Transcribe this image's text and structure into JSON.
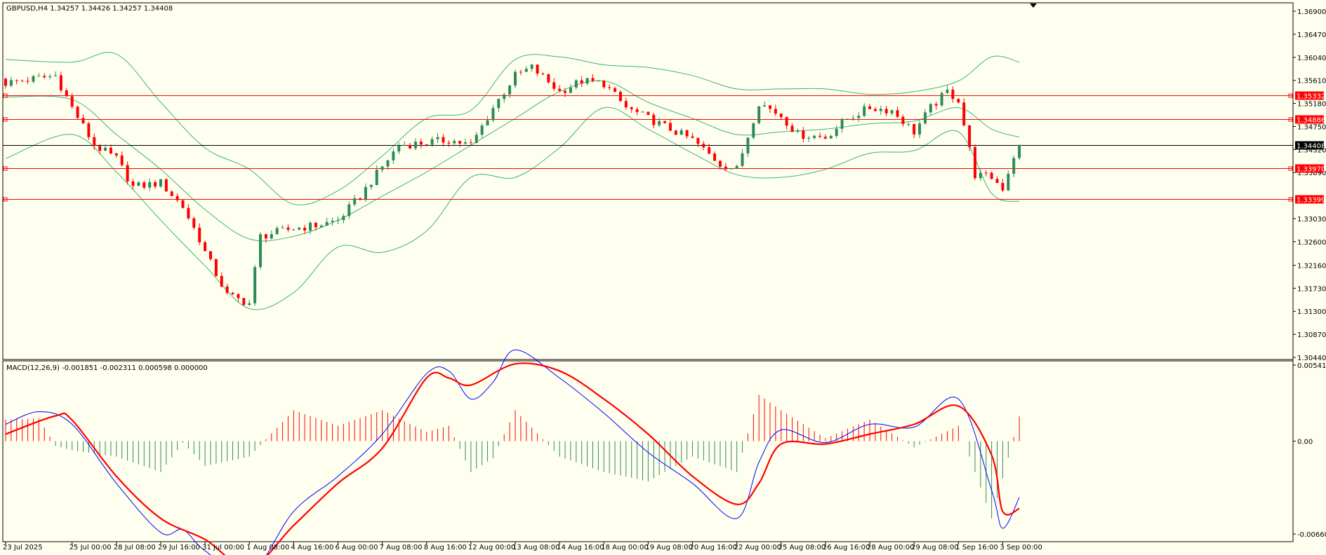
{
  "main_header": "GBPUSD,H4  1.34257 1.34426 1.34257 1.34408",
  "macd_header": "MACD(12,26,9) -0.001851 -0.002311 0.000598 0.000000",
  "colors": {
    "background": "#fffff0",
    "bull": "#2e8b57",
    "bear": "#ff0000",
    "bands": "#3cb371",
    "hline": "#ff0000",
    "current_price_line": "#000000",
    "macd_main": "#0000ff",
    "macd_signal": "#ff0000"
  },
  "chart_data": [
    {
      "type": "candlestick",
      "symbol": "GBPUSD",
      "timeframe": "H4",
      "last_ohlc": {
        "open": 1.34257,
        "high": 1.34426,
        "low": 1.34257,
        "close": 1.34408
      },
      "y_ticks": [
        "1.36900",
        "1.36470",
        "1.36040",
        "1.35610",
        "1.35180",
        "1.34750",
        "1.34320",
        "1.33890",
        "1.33030",
        "1.32600",
        "1.32160",
        "1.31730",
        "1.31300",
        "1.30870",
        "1.30440"
      ],
      "ylim": [
        1.3044,
        1.3694
      ],
      "x_ticks": [
        "23 Jul 2025",
        "25 Jul 00:00",
        "28 Jul 08:00",
        "29 Jul 16:00",
        "31 Jul 00:00",
        "1 Aug 08:00",
        "4 Aug 16:00",
        "6 Aug 00:00",
        "7 Aug 08:00",
        "8 Aug 16:00",
        "12 Aug 00:00",
        "13 Aug 08:00",
        "14 Aug 16:00",
        "18 Aug 00:00",
        "19 Aug 08:00",
        "20 Aug 16:00",
        "22 Aug 00:00",
        "25 Aug 08:00",
        "26 Aug 16:00",
        "28 Aug 00:00",
        "29 Aug 08:00",
        "1 Sep 16:00",
        "3 Sep 00:00"
      ],
      "indicator": "Bollinger Bands",
      "horizontal_levels": [
        {
          "label": "1.35332",
          "value": 1.35332
        },
        {
          "label": "1.34886",
          "value": 1.34886
        },
        {
          "label": "1.34408",
          "value": 1.34408,
          "current": true
        },
        {
          "label": "1.33970",
          "value": 1.3397
        },
        {
          "label": "1.33399",
          "value": 1.33399
        }
      ],
      "close_path": [
        {
          "x": "23 Jul 2025",
          "y": 1.3556
        },
        {
          "x": "24 Jul 12:00",
          "y": 1.357
        },
        {
          "x": "25 Jul 00:00",
          "y": 1.351
        },
        {
          "x": "25 Jul 16:00",
          "y": 1.344
        },
        {
          "x": "28 Jul 08:00",
          "y": 1.3415
        },
        {
          "x": "28 Jul 20:00",
          "y": 1.3362
        },
        {
          "x": "29 Jul 16:00",
          "y": 1.337
        },
        {
          "x": "30 Jul 08:00",
          "y": 1.3325
        },
        {
          "x": "30 Jul 20:00",
          "y": 1.3265
        },
        {
          "x": "31 Jul 00:00",
          "y": 1.324
        },
        {
          "x": "31 Jul 16:00",
          "y": 1.316
        },
        {
          "x": "1 Aug 08:00",
          "y": 1.3145
        },
        {
          "x": "1 Aug 16:00",
          "y": 1.327
        },
        {
          "x": "4 Aug 16:00",
          "y": 1.3285
        },
        {
          "x": "5 Aug 08:00",
          "y": 1.329
        },
        {
          "x": "6 Aug 00:00",
          "y": 1.33
        },
        {
          "x": "6 Aug 16:00",
          "y": 1.3345
        },
        {
          "x": "7 Aug 08:00",
          "y": 1.34
        },
        {
          "x": "7 Aug 20:00",
          "y": 1.344
        },
        {
          "x": "8 Aug 16:00",
          "y": 1.3445
        },
        {
          "x": "11 Aug 08:00",
          "y": 1.345
        },
        {
          "x": "12 Aug 00:00",
          "y": 1.344
        },
        {
          "x": "12 Aug 16:00",
          "y": 1.351
        },
        {
          "x": "13 Aug 08:00",
          "y": 1.357
        },
        {
          "x": "13 Aug 20:00",
          "y": 1.3585
        },
        {
          "x": "14 Aug 16:00",
          "y": 1.354
        },
        {
          "x": "15 Aug 08:00",
          "y": 1.356
        },
        {
          "x": "18 Aug 00:00",
          "y": 1.3555
        },
        {
          "x": "18 Aug 16:00",
          "y": 1.351
        },
        {
          "x": "19 Aug 08:00",
          "y": 1.349
        },
        {
          "x": "19 Aug 20:00",
          "y": 1.3475
        },
        {
          "x": "20 Aug 16:00",
          "y": 1.345
        },
        {
          "x": "21 Aug 12:00",
          "y": 1.3405
        },
        {
          "x": "22 Aug 00:00",
          "y": 1.3395
        },
        {
          "x": "22 Aug 16:00",
          "y": 1.352
        },
        {
          "x": "25 Aug 08:00",
          "y": 1.3495
        },
        {
          "x": "25 Aug 20:00",
          "y": 1.346
        },
        {
          "x": "26 Aug 16:00",
          "y": 1.3455
        },
        {
          "x": "27 Aug 08:00",
          "y": 1.349
        },
        {
          "x": "28 Aug 00:00",
          "y": 1.351
        },
        {
          "x": "28 Aug 16:00",
          "y": 1.3505
        },
        {
          "x": "29 Aug 08:00",
          "y": 1.3465
        },
        {
          "x": "29 Aug 20:00",
          "y": 1.351
        },
        {
          "x": "1 Sep 08:00",
          "y": 1.354
        },
        {
          "x": "1 Sep 16:00",
          "y": 1.3525
        },
        {
          "x": "2 Sep 04:00",
          "y": 1.3385
        },
        {
          "x": "2 Sep 16:00",
          "y": 1.338
        },
        {
          "x": "3 Sep 00:00",
          "y": 1.336
        },
        {
          "x": "3 Sep 08:00",
          "y": 1.342
        },
        {
          "x": "3 Sep 12:00",
          "y": 1.3441
        }
      ],
      "bollinger_upper": [
        {
          "x": "23 Jul 2025",
          "y": 1.36
        },
        {
          "x": "25 Jul 00:00",
          "y": 1.3595
        },
        {
          "x": "28 Jul 08:00",
          "y": 1.361
        },
        {
          "x": "29 Jul 16:00",
          "y": 1.352
        },
        {
          "x": "31 Jul 00:00",
          "y": 1.3435
        },
        {
          "x": "1 Aug 08:00",
          "y": 1.3395
        },
        {
          "x": "4 Aug 16:00",
          "y": 1.333
        },
        {
          "x": "6 Aug 00:00",
          "y": 1.3355
        },
        {
          "x": "7 Aug 08:00",
          "y": 1.342
        },
        {
          "x": "8 Aug 16:00",
          "y": 1.349
        },
        {
          "x": "12 Aug 00:00",
          "y": 1.3505
        },
        {
          "x": "13 Aug 08:00",
          "y": 1.36
        },
        {
          "x": "14 Aug 16:00",
          "y": 1.3605
        },
        {
          "x": "18 Aug 00:00",
          "y": 1.359
        },
        {
          "x": "19 Aug 08:00",
          "y": 1.3585
        },
        {
          "x": "20 Aug 16:00",
          "y": 1.357
        },
        {
          "x": "22 Aug 00:00",
          "y": 1.3545
        },
        {
          "x": "25 Aug 08:00",
          "y": 1.3545
        },
        {
          "x": "26 Aug 16:00",
          "y": 1.3545
        },
        {
          "x": "28 Aug 00:00",
          "y": 1.3535
        },
        {
          "x": "29 Aug 08:00",
          "y": 1.354
        },
        {
          "x": "1 Sep 16:00",
          "y": 1.356
        },
        {
          "x": "2 Sep 16:00",
          "y": 1.3605
        },
        {
          "x": "3 Sep 12:00",
          "y": 1.3595
        }
      ],
      "bollinger_middle": [
        {
          "x": "23 Jul 2025",
          "y": 1.353
        },
        {
          "x": "25 Jul 00:00",
          "y": 1.3525
        },
        {
          "x": "28 Jul 08:00",
          "y": 1.346
        },
        {
          "x": "29 Jul 16:00",
          "y": 1.3395
        },
        {
          "x": "31 Jul 00:00",
          "y": 1.332
        },
        {
          "x": "1 Aug 08:00",
          "y": 1.3265
        },
        {
          "x": "4 Aug 16:00",
          "y": 1.327
        },
        {
          "x": "6 Aug 00:00",
          "y": 1.33
        },
        {
          "x": "7 Aug 08:00",
          "y": 1.3345
        },
        {
          "x": "8 Aug 16:00",
          "y": 1.339
        },
        {
          "x": "12 Aug 00:00",
          "y": 1.344
        },
        {
          "x": "13 Aug 08:00",
          "y": 1.349
        },
        {
          "x": "14 Aug 16:00",
          "y": 1.354
        },
        {
          "x": "18 Aug 00:00",
          "y": 1.356
        },
        {
          "x": "19 Aug 08:00",
          "y": 1.352
        },
        {
          "x": "20 Aug 16:00",
          "y": 1.349
        },
        {
          "x": "22 Aug 00:00",
          "y": 1.346
        },
        {
          "x": "25 Aug 08:00",
          "y": 1.3465
        },
        {
          "x": "26 Aug 16:00",
          "y": 1.347
        },
        {
          "x": "28 Aug 00:00",
          "y": 1.348
        },
        {
          "x": "29 Aug 08:00",
          "y": 1.3485
        },
        {
          "x": "1 Sep 16:00",
          "y": 1.351
        },
        {
          "x": "2 Sep 16:00",
          "y": 1.347
        },
        {
          "x": "3 Sep 12:00",
          "y": 1.3455
        }
      ],
      "bollinger_lower": [
        {
          "x": "23 Jul 2025",
          "y": 1.3415
        },
        {
          "x": "25 Jul 00:00",
          "y": 1.346
        },
        {
          "x": "28 Jul 08:00",
          "y": 1.339
        },
        {
          "x": "29 Jul 16:00",
          "y": 1.33
        },
        {
          "x": "31 Jul 00:00",
          "y": 1.3215
        },
        {
          "x": "1 Aug 08:00",
          "y": 1.3135
        },
        {
          "x": "4 Aug 16:00",
          "y": 1.3165
        },
        {
          "x": "6 Aug 00:00",
          "y": 1.325
        },
        {
          "x": "7 Aug 08:00",
          "y": 1.324
        },
        {
          "x": "8 Aug 16:00",
          "y": 1.328
        },
        {
          "x": "12 Aug 00:00",
          "y": 1.338
        },
        {
          "x": "13 Aug 08:00",
          "y": 1.338
        },
        {
          "x": "14 Aug 16:00",
          "y": 1.3435
        },
        {
          "x": "18 Aug 00:00",
          "y": 1.351
        },
        {
          "x": "19 Aug 08:00",
          "y": 1.347
        },
        {
          "x": "20 Aug 16:00",
          "y": 1.3425
        },
        {
          "x": "22 Aug 00:00",
          "y": 1.3385
        },
        {
          "x": "25 Aug 08:00",
          "y": 1.338
        },
        {
          "x": "26 Aug 16:00",
          "y": 1.3395
        },
        {
          "x": "28 Aug 00:00",
          "y": 1.3425
        },
        {
          "x": "29 Aug 08:00",
          "y": 1.343
        },
        {
          "x": "1 Sep 16:00",
          "y": 1.3465
        },
        {
          "x": "2 Sep 16:00",
          "y": 1.335
        },
        {
          "x": "3 Sep 12:00",
          "y": 1.3335
        }
      ]
    },
    {
      "type": "line",
      "indicator": "MACD(12,26,9)",
      "y_ticks": [
        "0.005416",
        "0.00",
        "-0.006609"
      ],
      "ylim": [
        -0.006609,
        0.005416
      ],
      "series": [
        {
          "name": "MACD main",
          "color": "#0000ff",
          "values": [
            {
              "x": "23 Jul 2025",
              "y": 0.0012
            },
            {
              "x": "24 Jul 00:00",
              "y": 0.0021
            },
            {
              "x": "25 Jul 00:00",
              "y": 0.0012
            },
            {
              "x": "28 Jul 08:00",
              "y": -0.003
            },
            {
              "x": "29 Jul 16:00",
              "y": -0.0065
            },
            {
              "x": "30 Jul 08:00",
              "y": -0.0063
            },
            {
              "x": "31 Jul 00:00",
              "y": -0.0078
            },
            {
              "x": "1 Aug 08:00",
              "y": -0.0095
            },
            {
              "x": "4 Aug 16:00",
              "y": -0.005
            },
            {
              "x": "6 Aug 00:00",
              "y": -0.0025
            },
            {
              "x": "7 Aug 08:00",
              "y": 0.0005
            },
            {
              "x": "8 Aug 16:00",
              "y": 0.0048
            },
            {
              "x": "11 Aug 08:00",
              "y": 0.005
            },
            {
              "x": "12 Aug 00:00",
              "y": 0.003
            },
            {
              "x": "12 Aug 16:00",
              "y": 0.0042
            },
            {
              "x": "13 Aug 08:00",
              "y": 0.0065
            },
            {
              "x": "14 Aug 16:00",
              "y": 0.0045
            },
            {
              "x": "18 Aug 00:00",
              "y": 0.002
            },
            {
              "x": "19 Aug 08:00",
              "y": -0.0008
            },
            {
              "x": "20 Aug 16:00",
              "y": -0.003
            },
            {
              "x": "22 Aug 00:00",
              "y": -0.0055
            },
            {
              "x": "22 Aug 16:00",
              "y": -0.0015
            },
            {
              "x": "25 Aug 08:00",
              "y": 0.0008
            },
            {
              "x": "26 Aug 16:00",
              "y": -0.0001
            },
            {
              "x": "28 Aug 00:00",
              "y": 0.0012
            },
            {
              "x": "29 Aug 08:00",
              "y": 0.001
            },
            {
              "x": "1 Sep 16:00",
              "y": 0.003
            },
            {
              "x": "2 Sep 16:00",
              "y": -0.0035
            },
            {
              "x": "3 Sep 00:00",
              "y": -0.0062
            },
            {
              "x": "3 Sep 12:00",
              "y": -0.004
            }
          ]
        },
        {
          "name": "MACD signal",
          "color": "#ff0000",
          "values": [
            {
              "x": "23 Jul 2025",
              "y": 0.0005
            },
            {
              "x": "24 Jul 12:00",
              "y": 0.0018
            },
            {
              "x": "25 Jul 00:00",
              "y": 0.0015
            },
            {
              "x": "28 Jul 08:00",
              "y": -0.0025
            },
            {
              "x": "29 Jul 16:00",
              "y": -0.0055
            },
            {
              "x": "31 Jul 00:00",
              "y": -0.007
            },
            {
              "x": "1 Aug 08:00",
              "y": -0.009
            },
            {
              "x": "4 Aug 16:00",
              "y": -0.006
            },
            {
              "x": "6 Aug 00:00",
              "y": -0.003
            },
            {
              "x": "7 Aug 08:00",
              "y": -0.0005
            },
            {
              "x": "8 Aug 16:00",
              "y": 0.0045
            },
            {
              "x": "11 Aug 08:00",
              "y": 0.0045
            },
            {
              "x": "12 Aug 00:00",
              "y": 0.004
            },
            {
              "x": "13 Aug 08:00",
              "y": 0.0055
            },
            {
              "x": "14 Aug 16:00",
              "y": 0.005
            },
            {
              "x": "18 Aug 00:00",
              "y": 0.003
            },
            {
              "x": "19 Aug 08:00",
              "y": 0.0005
            },
            {
              "x": "20 Aug 16:00",
              "y": -0.0025
            },
            {
              "x": "22 Aug 00:00",
              "y": -0.0045
            },
            {
              "x": "22 Aug 16:00",
              "y": -0.003
            },
            {
              "x": "25 Aug 08:00",
              "y": -0.0002
            },
            {
              "x": "26 Aug 16:00",
              "y": -0.0002
            },
            {
              "x": "28 Aug 00:00",
              "y": 0.0005
            },
            {
              "x": "29 Aug 08:00",
              "y": 0.0012
            },
            {
              "x": "1 Sep 16:00",
              "y": 0.0025
            },
            {
              "x": "2 Sep 16:00",
              "y": -0.001
            },
            {
              "x": "3 Sep 00:00",
              "y": -0.005
            },
            {
              "x": "3 Sep 12:00",
              "y": -0.0048
            }
          ]
        }
      ]
    }
  ]
}
